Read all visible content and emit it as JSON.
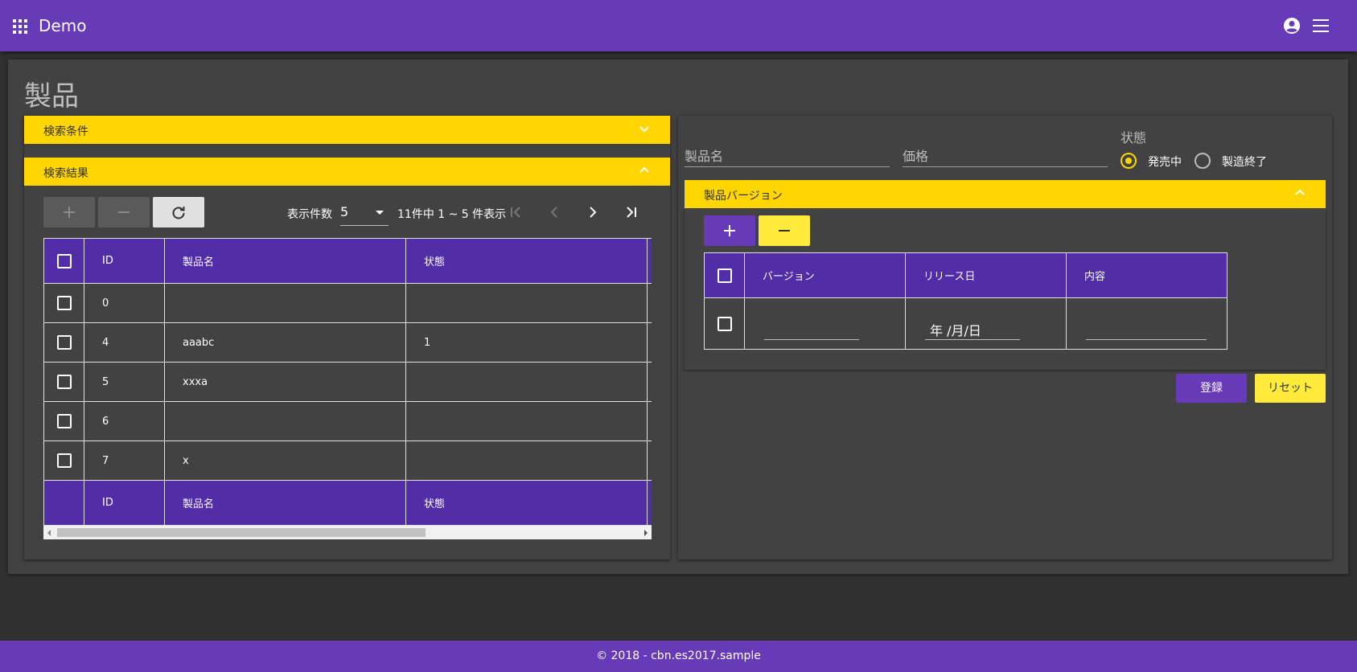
{
  "app": {
    "title": "Demo"
  },
  "page": {
    "title": "製品"
  },
  "search_panel": {
    "label": "検索条件"
  },
  "results_panel": {
    "label": "検索結果"
  },
  "toolbar": {
    "page_size_label": "表示件数",
    "page_size_value": "5",
    "range_label": "11件中 1 ~ 5 件表示"
  },
  "grid": {
    "columns": [
      "ID",
      "製品名",
      "状態"
    ],
    "rows": [
      {
        "id": "0",
        "name": "",
        "status": ""
      },
      {
        "id": "4",
        "name": "aaabc",
        "status": "1"
      },
      {
        "id": "5",
        "name": "xxxa",
        "status": ""
      },
      {
        "id": "6",
        "name": "",
        "status": ""
      },
      {
        "id": "7",
        "name": "x",
        "status": ""
      }
    ]
  },
  "form": {
    "name_placeholder": "製品名",
    "price_placeholder": "価格",
    "status_label": "状態",
    "status_options": [
      "発売中",
      "製造終了"
    ],
    "status_selected": "発売中"
  },
  "versions_panel": {
    "label": "製品バージョン",
    "columns": [
      "バージョン",
      "リリース日",
      "内容"
    ],
    "date_placeholder": "年 /月/日"
  },
  "actions": {
    "register": "登録",
    "reset": "リセット"
  },
  "footer": {
    "text": "© 2018 - cbn.es2017.sample"
  },
  "colors": {
    "primary": "#673ab7",
    "header_cell": "#512da8",
    "accent": "#ffd600",
    "button_yellow": "#ffeb3b"
  }
}
